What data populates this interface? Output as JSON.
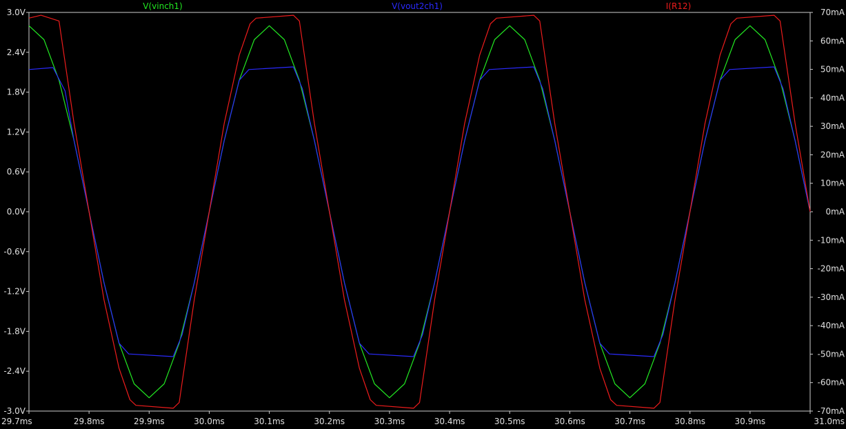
{
  "chart_data": {
    "type": "line",
    "xlabel": "",
    "ylabel": "",
    "x_range": [
      29.7,
      31.0
    ],
    "x_ticks": [
      "29.7ms",
      "29.8ms",
      "29.9ms",
      "30.0ms",
      "30.1ms",
      "30.2ms",
      "30.3ms",
      "30.4ms",
      "30.5ms",
      "30.6ms",
      "30.7ms",
      "30.8ms",
      "30.9ms",
      "31.0ms"
    ],
    "left_axis": {
      "range": [
        -3.0,
        3.0
      ],
      "ticks": [
        "3.0V",
        "2.4V",
        "1.8V",
        "1.2V",
        "0.6V",
        "0.0V",
        "-0.6V",
        "-1.2V",
        "-1.8V",
        "-2.4V",
        "-3.0V"
      ]
    },
    "right_axis": {
      "range": [
        -70,
        70
      ],
      "ticks": [
        "70mA",
        "60mA",
        "50mA",
        "40mA",
        "30mA",
        "20mA",
        "10mA",
        "0mA",
        "-10mA",
        "-20mA",
        "-30mA",
        "-40mA",
        "-50mA",
        "-60mA",
        "-70mA"
      ]
    },
    "grid": false,
    "legend_position": "top",
    "series": [
      {
        "name": "V(vinch1)",
        "color": "#22e822",
        "axis": "left",
        "x": [
          29.7,
          29.725,
          29.75,
          29.775,
          29.8,
          29.825,
          29.85,
          29.875,
          29.9,
          29.925,
          29.95,
          29.975,
          30.0,
          30.025,
          30.05,
          30.075,
          30.1,
          30.125,
          30.15,
          30.175,
          30.2,
          30.225,
          30.25,
          30.275,
          30.3,
          30.325,
          30.35,
          30.375,
          30.4,
          30.425,
          30.45,
          30.475,
          30.5,
          30.525,
          30.55,
          30.575,
          30.6,
          30.625,
          30.65,
          30.675,
          30.7,
          30.725,
          30.75,
          30.775,
          30.8,
          30.825,
          30.85,
          30.875,
          30.9,
          30.925,
          30.95,
          30.975,
          31.0
        ],
        "values": [
          2.8,
          2.59,
          1.98,
          1.07,
          0,
          -1.07,
          -1.98,
          -2.59,
          -2.8,
          -2.59,
          -1.98,
          -1.07,
          0,
          1.07,
          1.98,
          2.59,
          2.8,
          2.59,
          1.98,
          1.07,
          0,
          -1.07,
          -1.98,
          -2.59,
          -2.8,
          -2.59,
          -1.98,
          -1.07,
          0,
          1.07,
          1.98,
          2.59,
          2.8,
          2.59,
          1.98,
          1.07,
          0,
          -1.07,
          -1.98,
          -2.59,
          -2.8,
          -2.59,
          -1.98,
          -1.07,
          0,
          1.07,
          1.98,
          2.59,
          2.8,
          2.59,
          1.98,
          1.07,
          0
        ]
      },
      {
        "name": "V(vout2ch1)",
        "color": "#2a2aff",
        "axis": "left",
        "x": [
          29.7,
          29.74,
          29.76,
          29.775,
          29.8,
          29.825,
          29.85,
          29.866,
          29.94,
          29.955,
          29.975,
          30.0,
          30.025,
          30.05,
          30.066,
          30.14,
          30.155,
          30.175,
          30.2,
          30.225,
          30.25,
          30.266,
          30.34,
          30.355,
          30.375,
          30.4,
          30.425,
          30.45,
          30.466,
          30.54,
          30.555,
          30.575,
          30.6,
          30.625,
          30.65,
          30.666,
          30.74,
          30.755,
          30.775,
          30.8,
          30.825,
          30.85,
          30.866,
          30.94,
          30.955,
          30.975,
          31.0
        ],
        "values": [
          2.14,
          2.17,
          1.82,
          1.07,
          0,
          -1.07,
          -1.98,
          -2.14,
          -2.18,
          -1.85,
          -1.07,
          0,
          1.07,
          1.98,
          2.14,
          2.18,
          1.85,
          1.07,
          0,
          -1.07,
          -1.98,
          -2.14,
          -2.18,
          -1.85,
          -1.07,
          0,
          1.07,
          1.98,
          2.14,
          2.18,
          1.85,
          1.07,
          0,
          -1.07,
          -1.98,
          -2.14,
          -2.18,
          -1.85,
          -1.07,
          0,
          1.07,
          1.98,
          2.14,
          2.18,
          1.85,
          1.07,
          0
        ]
      },
      {
        "name": "I(R12)",
        "color": "#ee1c1c",
        "axis": "right",
        "x": [
          29.7,
          29.72,
          29.75,
          29.775,
          29.8,
          29.825,
          29.85,
          29.868,
          29.878,
          29.94,
          29.95,
          29.975,
          30.0,
          30.025,
          30.05,
          30.068,
          30.078,
          30.14,
          30.15,
          30.175,
          30.2,
          30.225,
          30.25,
          30.268,
          30.278,
          30.34,
          30.35,
          30.375,
          30.4,
          30.425,
          30.45,
          30.468,
          30.478,
          30.54,
          30.55,
          30.575,
          30.6,
          30.625,
          30.65,
          30.668,
          30.678,
          30.74,
          30.75,
          30.775,
          30.8,
          30.825,
          30.85,
          30.868,
          30.878,
          30.94,
          30.95,
          30.975,
          31.0
        ],
        "values": [
          68,
          69,
          67,
          31,
          0,
          -31,
          -55,
          -66,
          -68,
          -69,
          -67,
          -31,
          0,
          31,
          55,
          66,
          68,
          69,
          67,
          31,
          0,
          -31,
          -55,
          -66,
          -68,
          -69,
          -67,
          -31,
          0,
          31,
          55,
          66,
          68,
          69,
          67,
          31,
          0,
          -31,
          -55,
          -66,
          -68,
          -69,
          -67,
          -31,
          0,
          31,
          55,
          66,
          68,
          69,
          67,
          31,
          0
        ]
      }
    ]
  }
}
